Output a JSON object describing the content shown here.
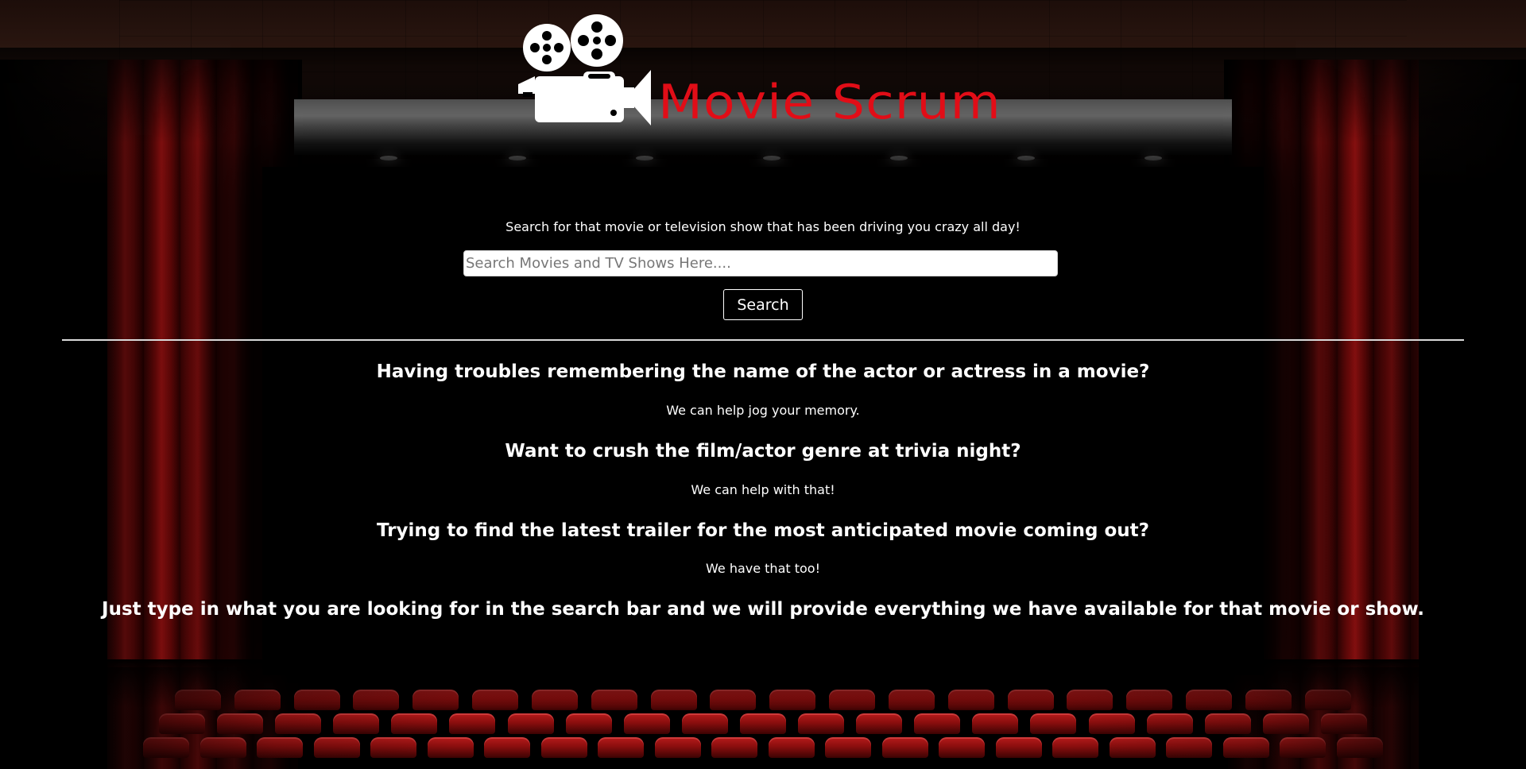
{
  "app": {
    "title": "Movie Scrum"
  },
  "header": {
    "logo_text": "Movie Scrum",
    "logo_icon": "film-camera-icon",
    "logo_color": "#e10d17"
  },
  "search": {
    "tagline": "Search for that movie or television show that has been driving you crazy all day!",
    "placeholder": "Search Movies and TV Shows Here....",
    "value": "",
    "button_label": "Search"
  },
  "info": {
    "items": [
      {
        "question": "Having troubles remembering the name of the actor or actress in a movie?",
        "answer": "We can help jog your memory."
      },
      {
        "question": "Want to crush the film/actor genre at trivia night?",
        "answer": "We can help with that!"
      },
      {
        "question": "Trying to find the latest trailer for the most anticipated movie coming out?",
        "answer": "We have that too!"
      }
    ],
    "closing": "Just type in what you are looking for in the search bar and we will provide everything we have available for that movie or show."
  }
}
